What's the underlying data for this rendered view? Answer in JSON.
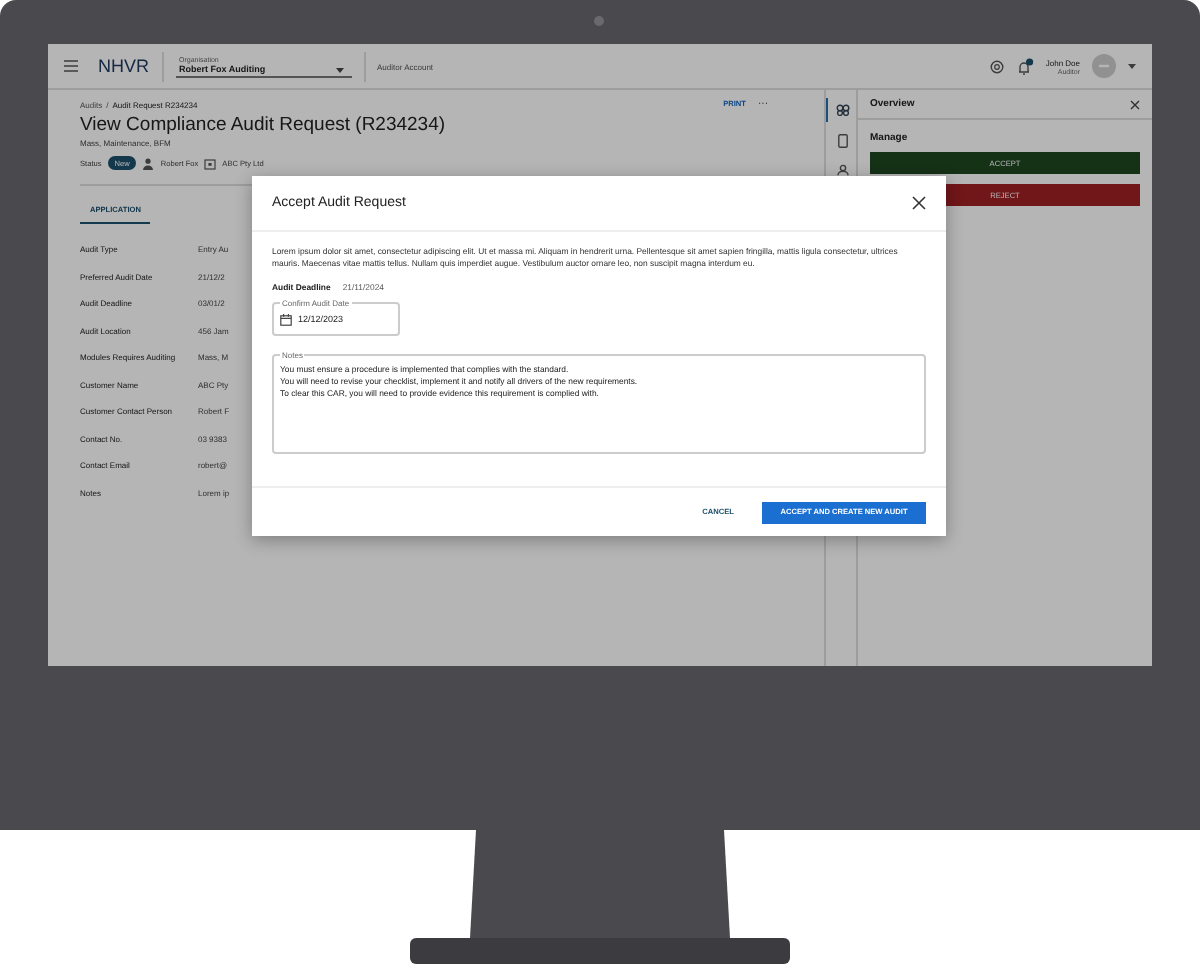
{
  "topbar": {
    "app_name": "NHVR",
    "organisation": {
      "label": "Organisation",
      "value": "Robert Fox Auditing"
    },
    "account": "Auditor Account",
    "user": {
      "name": "John Doe",
      "role": "Auditor"
    }
  },
  "breadcrumb": {
    "parent": "Audits",
    "separator": "/",
    "current": "Audit Request R234234"
  },
  "page": {
    "title": "View Compliance Audit Request (R234234)",
    "subtitle": "Mass, Maintenance, BFM",
    "status_label": "Status",
    "status": "New",
    "assignee": "Robert Fox",
    "company": "ABC Pty Ltd",
    "print": "PRINT",
    "more": "···"
  },
  "tabs": [
    {
      "label": "APPLICATION",
      "selected": true
    }
  ],
  "details": [
    {
      "label": "Audit Type",
      "value": "Entry Au"
    },
    {
      "label": "Preferred Audit Date",
      "value": "21/12/2"
    },
    {
      "label": "Audit Deadline",
      "value": "03/01/2"
    },
    {
      "label": "Audit Location",
      "value": "456 Jam"
    },
    {
      "label": "Modules Requires Auditing",
      "value": "Mass, M"
    },
    {
      "label": "Customer Name",
      "value": "ABC Pty"
    },
    {
      "label": "Customer Contact Person",
      "value": "Robert F"
    },
    {
      "label": "Contact No.",
      "value": "03 9383"
    },
    {
      "label": "Contact Email",
      "value": "robert@"
    },
    {
      "label": "Notes",
      "value": "Lorem ip"
    }
  ],
  "side_nav": [
    {
      "kind": "overview",
      "selected": true
    },
    {
      "kind": "document",
      "selected": false
    },
    {
      "kind": "people",
      "selected": false
    }
  ],
  "panel": {
    "title": "Overview",
    "section": "Manage",
    "buttons": [
      {
        "label": "ACCEPT",
        "kind": "accept"
      },
      {
        "label": "REJECT",
        "kind": "reject"
      }
    ]
  },
  "modal": {
    "title": "Accept Audit Request",
    "intro": "Lorem ipsum dolor sit amet, consectetur adipiscing elit. Ut et massa mi. Aliquam in hendrerit urna. Pellentesque sit amet sapien fringilla, mattis ligula consectetur, ultrices mauris. Maecenas vitae mattis tellus. Nullam quis imperdiet augue. Vestibulum auctor ornare leo, non suscipit magna interdum eu.",
    "deadline_label": "Audit Deadline",
    "deadline_value": "21/11/2024",
    "date_field": {
      "label": "Confirm Audit Date",
      "value": "12/12/2023"
    },
    "notes": {
      "label": "Notes",
      "value": "You must ensure a procedure is implemented that complies with the standard.\nYou will need to revise your checklist, implement it and notify all drivers of the new requirements.\nTo clear this CAR, you will need to provide evidence this requirement is complied with."
    },
    "buttons": [
      {
        "label": "CANCEL",
        "kind": "text"
      },
      {
        "label": "ACCEPT AND CREATE NEW AUDIT",
        "kind": "primary"
      }
    ]
  }
}
